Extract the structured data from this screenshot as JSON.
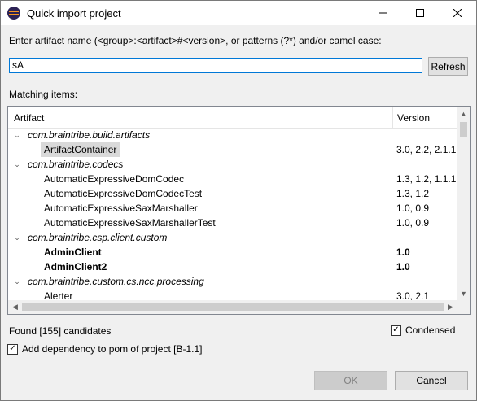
{
  "window": {
    "title": "Quick import project"
  },
  "prompt": "Enter artifact name (<group>:<artifact>#<version>, or patterns (?*) and/or camel case:",
  "search": {
    "value": "sA"
  },
  "refresh_label": "Refresh",
  "matching_label": "Matching items:",
  "columns": {
    "artifact": "Artifact",
    "version": "Version"
  },
  "rows": [
    {
      "type": "group",
      "name": "com.braintribe.build.artifacts"
    },
    {
      "type": "item",
      "name": "ArtifactContainer",
      "version": "3.0, 2.2, 2.1.1,",
      "selected": true
    },
    {
      "type": "group",
      "name": "com.braintribe.codecs"
    },
    {
      "type": "item",
      "name": "AutomaticExpressiveDomCodec",
      "version": "1.3, 1.2, 1.1.1,"
    },
    {
      "type": "item",
      "name": "AutomaticExpressiveDomCodecTest",
      "version": "1.3, 1.2"
    },
    {
      "type": "item",
      "name": "AutomaticExpressiveSaxMarshaller",
      "version": "1.0, 0.9"
    },
    {
      "type": "item",
      "name": "AutomaticExpressiveSaxMarshallerTest",
      "version": "1.0, 0.9"
    },
    {
      "type": "group",
      "name": "com.braintribe.csp.client.custom"
    },
    {
      "type": "item",
      "name": "AdminClient",
      "version": "1.0",
      "bold": true
    },
    {
      "type": "item",
      "name": "AdminClient2",
      "version": "1.0",
      "bold": true
    },
    {
      "type": "group",
      "name": "com.braintribe.custom.cs.ncc.processing"
    },
    {
      "type": "item",
      "name": "Alerter",
      "version": "3.0, 2.1"
    }
  ],
  "found_text": "Found [155] candidates",
  "condensed": {
    "label": "Condensed",
    "checked": true
  },
  "add_dependency": {
    "label": "Add dependency to pom of project [B-1.1]",
    "checked": true
  },
  "ok_label": "OK",
  "cancel_label": "Cancel",
  "icons": {
    "app": "eclipse-icon",
    "minimize": "minimize-icon",
    "maximize": "maximize-icon",
    "close": "close-icon",
    "expand": "chevron-down-icon"
  }
}
